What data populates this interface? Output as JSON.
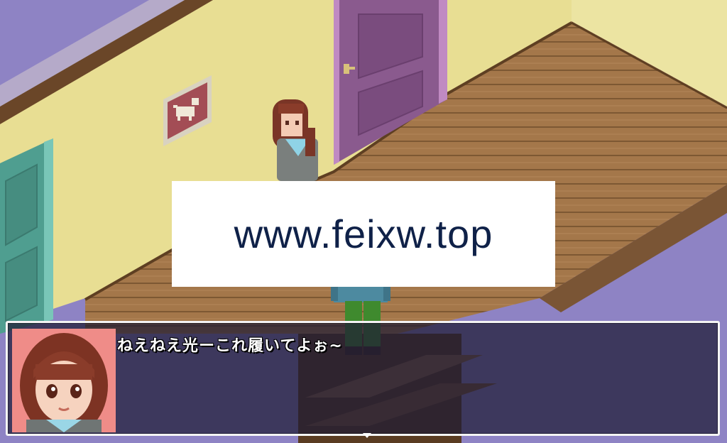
{
  "watermark": {
    "text": "www.feixw.top"
  },
  "dialogue": {
    "message": "ねえねえ光ーこれ履いてよぉ~",
    "speaker_face": "brown-haired-girl-portrait"
  },
  "scene": {
    "location": "isometric-hallway",
    "colors": {
      "wall": "#e8de93",
      "floor": "#a4774a",
      "purple_door": "#8a5a8e",
      "teal_door": "#4f9e90",
      "backdrop": "#8e83c4"
    }
  },
  "icons": {
    "cat_picture": "cat-picture-icon",
    "continue": "continue-arrow-icon"
  }
}
